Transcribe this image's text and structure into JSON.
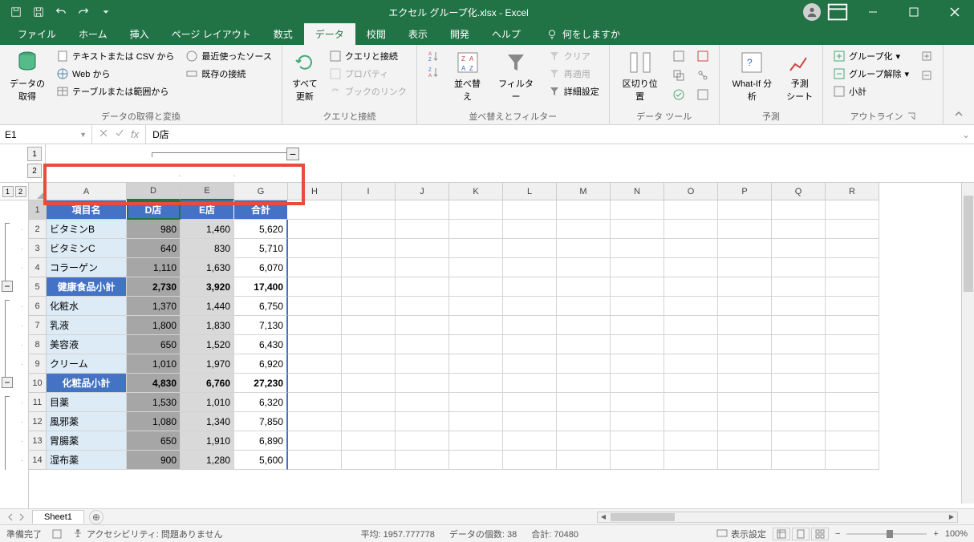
{
  "title": "エクセル グループ化.xlsx  -  Excel",
  "tabs": {
    "file": "ファイル",
    "home": "ホーム",
    "insert": "挿入",
    "layout": "ページ レイアウト",
    "formulas": "数式",
    "data": "データ",
    "review": "校閲",
    "view": "表示",
    "developer": "開発",
    "help": "ヘルプ",
    "tellme": "何をしますか"
  },
  "ribbon": {
    "get_transform": {
      "label": "データの取得と変換",
      "get_data": "データの\n取得",
      "csv": "テキストまたは CSV から",
      "web": "Web から",
      "table": "テーブルまたは範囲から",
      "recent": "最近使ったソース",
      "existing": "既存の接続"
    },
    "queries": {
      "label": "クエリと接続",
      "refresh": "すべて\n更新",
      "conn": "クエリと接続",
      "prop": "プロパティ",
      "links": "ブックのリンク"
    },
    "sort_filter": {
      "label": "並べ替えとフィルター",
      "sort": "並べ替え",
      "filter": "フィルター",
      "clear": "クリア",
      "reapply": "再適用",
      "advanced": "詳細設定",
      "az": "A→Z",
      "za": "Z→A"
    },
    "data_tools": {
      "label": "データ ツール",
      "text_cols": "区切り位置"
    },
    "forecast": {
      "label": "予測",
      "whatif": "What-If 分析",
      "forecast": "予測\nシート"
    },
    "outline": {
      "label": "アウトライン",
      "group": "グループ化",
      "ungroup": "グループ解除",
      "subtotal": "小計"
    }
  },
  "formula_bar": {
    "name_box": "E1",
    "value": "D店"
  },
  "col_outline": {
    "level1": "1",
    "level2": "2",
    "collapse": "−"
  },
  "row_outline": {
    "level1": "1",
    "level2": "2",
    "collapse": "−"
  },
  "columns": [
    "A",
    "D",
    "E",
    "G",
    "H",
    "I",
    "J",
    "K",
    "L",
    "M",
    "N",
    "O",
    "P",
    "Q",
    "R"
  ],
  "row_nums": [
    "1",
    "2",
    "3",
    "4",
    "5",
    "6",
    "7",
    "8",
    "9",
    "10",
    "11",
    "12",
    "13",
    "14"
  ],
  "headers": {
    "item": "項目名",
    "d": "D店",
    "e": "E店",
    "total": "合計"
  },
  "data_rows": [
    {
      "item": "ビタミンB",
      "d": "980",
      "e": "1,460",
      "total": "5,620"
    },
    {
      "item": "ビタミンC",
      "d": "640",
      "e": "830",
      "total": "5,710"
    },
    {
      "item": "コラーゲン",
      "d": "1,110",
      "e": "1,630",
      "total": "6,070"
    },
    {
      "item": "健康食品小計",
      "d": "2,730",
      "e": "3,920",
      "total": "17,400",
      "subtotal": true
    },
    {
      "item": "化粧水",
      "d": "1,370",
      "e": "1,440",
      "total": "6,750"
    },
    {
      "item": "乳液",
      "d": "1,800",
      "e": "1,830",
      "total": "7,130"
    },
    {
      "item": "美容液",
      "d": "650",
      "e": "1,520",
      "total": "6,430"
    },
    {
      "item": "クリーム",
      "d": "1,010",
      "e": "1,970",
      "total": "6,920"
    },
    {
      "item": "化粧品小計",
      "d": "4,830",
      "e": "6,760",
      "total": "27,230",
      "subtotal": true
    },
    {
      "item": "目薬",
      "d": "1,530",
      "e": "1,010",
      "total": "6,320"
    },
    {
      "item": "風邪薬",
      "d": "1,080",
      "e": "1,340",
      "total": "7,850"
    },
    {
      "item": "胃腸薬",
      "d": "650",
      "e": "1,910",
      "total": "6,890"
    },
    {
      "item": "湿布薬",
      "d": "900",
      "e": "1,280",
      "total": "5,600"
    }
  ],
  "sheet": {
    "name": "Sheet1"
  },
  "status": {
    "ready": "準備完了",
    "acc": "アクセシビリティ: 問題ありません",
    "avg": "平均: 1957.777778",
    "count": "データの個数: 38",
    "sum": "合計: 70480",
    "display": "表示設定",
    "zoom": "100%"
  }
}
